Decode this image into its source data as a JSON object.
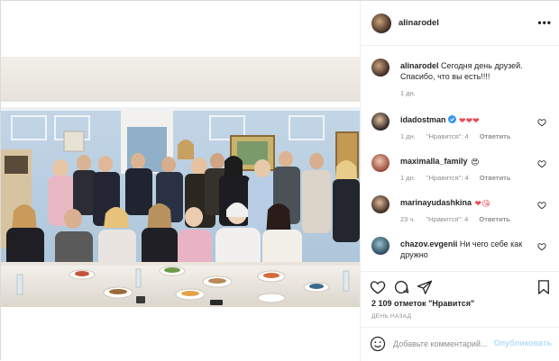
{
  "post": {
    "username": "alinarodel",
    "more_label": "•••"
  },
  "caption": {
    "username": "alinarodel",
    "text": "Сегодня день друзей. Спасибо, что вы есть!!!!",
    "time": "1 дн."
  },
  "comments": [
    {
      "username": "idadostman",
      "verified": true,
      "text": "",
      "emojis": "❤❤❤",
      "time": "1 дн.",
      "likes": "\"Нравится\": 4",
      "reply": "Ответить"
    },
    {
      "username": "maximalla_family",
      "verified": false,
      "text": "",
      "emojis": "😍",
      "time": "1 дн.",
      "likes": "\"Нравится\": 4",
      "reply": "Ответить"
    },
    {
      "username": "marinayudashkina",
      "verified": false,
      "text": "",
      "emojis": "❤😘",
      "time": "23 ч.",
      "likes": "\"Нравится\": 4",
      "reply": "Ответить"
    },
    {
      "username": "chazov.evgenii",
      "verified": false,
      "text": "Ни чего себе как дружно",
      "emojis": "",
      "time": "",
      "likes": "",
      "reply": ""
    }
  ],
  "stats": {
    "likes_count": "2 109",
    "likes_suffix": "отметок \"Нравится\"",
    "posted": "ДЕНЬ НАЗАД"
  },
  "add_comment": {
    "placeholder": "Добавьте комментарий...",
    "publish_label": "Опубликовать"
  },
  "icons": {
    "more": "more-dots-icon",
    "like": "heart-outline-icon",
    "comment": "speech-bubble-icon",
    "share": "paper-plane-icon",
    "save": "bookmark-icon",
    "emoji": "smiley-icon",
    "verified": "verified-badge-icon"
  },
  "colors": {
    "border": "#dbdbdb",
    "meta_gray": "#8e8e8e",
    "verified_blue": "#3897f0",
    "publish_disabled": "#b2dffc",
    "emoji_heart": "#ed4956"
  }
}
